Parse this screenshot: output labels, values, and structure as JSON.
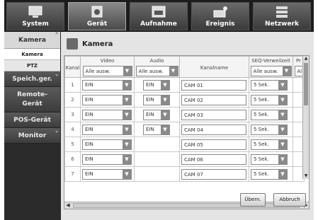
{
  "topnav": [
    {
      "label": "System",
      "icon": "monitor-icon"
    },
    {
      "label": "Gerät",
      "icon": "camera-icon"
    },
    {
      "label": "Aufnahme",
      "icon": "rec-icon"
    },
    {
      "label": "Ereignis",
      "icon": "alarm-icon"
    },
    {
      "label": "Netzwerk",
      "icon": "network-icon"
    }
  ],
  "sidebar": {
    "camera": "Kamera",
    "sub_camera": "Kamera",
    "sub_ptz": "PTZ",
    "storage": "Speich.ger.",
    "remote": "Remote-Gerät",
    "pos": "POS-Gerät",
    "monitor": "Monitor"
  },
  "page": {
    "title": "Kamera"
  },
  "table": {
    "headers": {
      "kanal": "Kanal",
      "video": "Video",
      "audio": "Audio",
      "name": "Kanalname",
      "seq": "SEQ-Verweilzeit",
      "extra": "Pr"
    },
    "header_selects": {
      "video": "Alle ausw.",
      "audio": "Alle ausw.",
      "seq": "Alle ausw.",
      "extra": "Al"
    },
    "rows": [
      {
        "n": "1",
        "video": "EIN",
        "audio": "EIN",
        "name": "CAM 01",
        "seq": "5 Sek."
      },
      {
        "n": "2",
        "video": "EIN",
        "audio": "EIN",
        "name": "CAM 02",
        "seq": "5 Sek."
      },
      {
        "n": "3",
        "video": "EIN",
        "audio": "EIN",
        "name": "CAM 03",
        "seq": "5 Sek."
      },
      {
        "n": "4",
        "video": "EIN",
        "audio": "EIN",
        "name": "CAM 04",
        "seq": "5 Sek."
      },
      {
        "n": "5",
        "video": "EIN",
        "audio": "",
        "name": "CAM 05",
        "seq": "5 Sek."
      },
      {
        "n": "6",
        "video": "EIN",
        "audio": "",
        "name": "CAM 06",
        "seq": "5 Sek."
      },
      {
        "n": "7",
        "video": "EIN",
        "audio": "",
        "name": "CAM 07",
        "seq": "5 Sek."
      }
    ]
  },
  "buttons": {
    "apply": "Übern.",
    "cancel": "Abbruch"
  }
}
